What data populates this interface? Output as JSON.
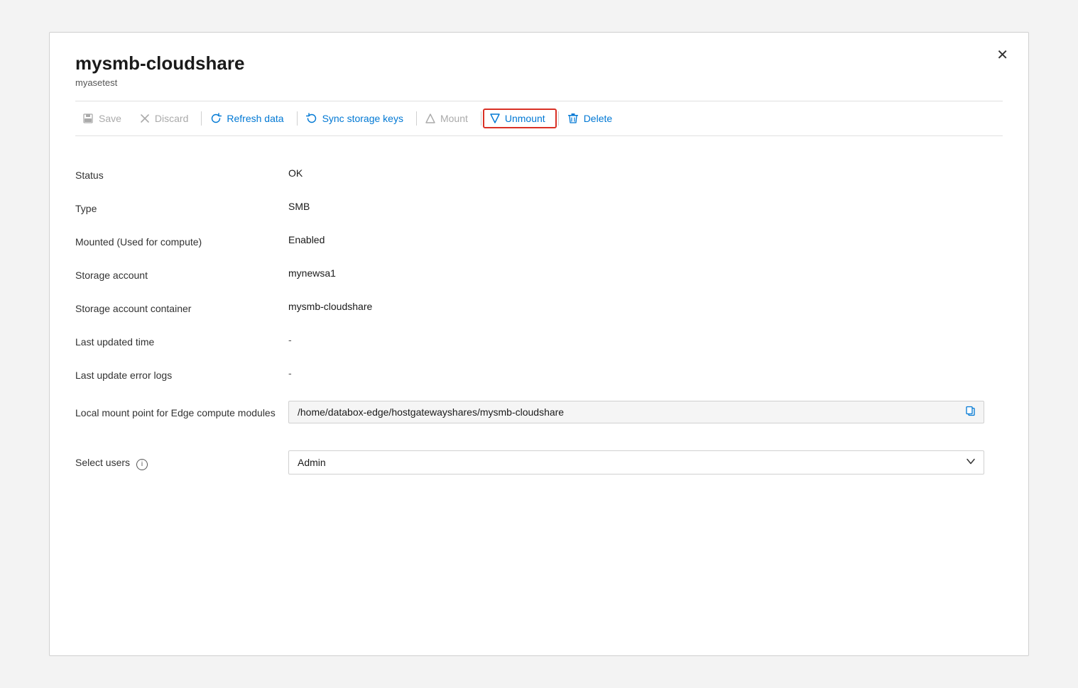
{
  "panel": {
    "title": "mysmb-cloudshare",
    "subtitle": "myasetest",
    "close_label": "✕"
  },
  "toolbar": {
    "save_label": "Save",
    "discard_label": "Discard",
    "refresh_label": "Refresh data",
    "sync_label": "Sync storage keys",
    "mount_label": "Mount",
    "unmount_label": "Unmount",
    "delete_label": "Delete"
  },
  "fields": {
    "status_label": "Status",
    "status_value": "OK",
    "type_label": "Type",
    "type_value": "SMB",
    "mounted_label": "Mounted (Used for compute)",
    "mounted_value": "Enabled",
    "storage_account_label": "Storage account",
    "storage_account_value": "mynewsa1",
    "container_label": "Storage account container",
    "container_value": "mysmb-cloudshare",
    "last_updated_label": "Last updated time",
    "last_updated_value": "-",
    "last_error_label": "Last update error logs",
    "last_error_value": "-",
    "local_mount_label": "Local mount point for Edge compute modules",
    "local_mount_value": "/home/databox-edge/hostgatewayshares/mysmb-cloudshare",
    "select_users_label": "Select users",
    "select_users_value": "Admin",
    "info_icon_title": "Information"
  }
}
